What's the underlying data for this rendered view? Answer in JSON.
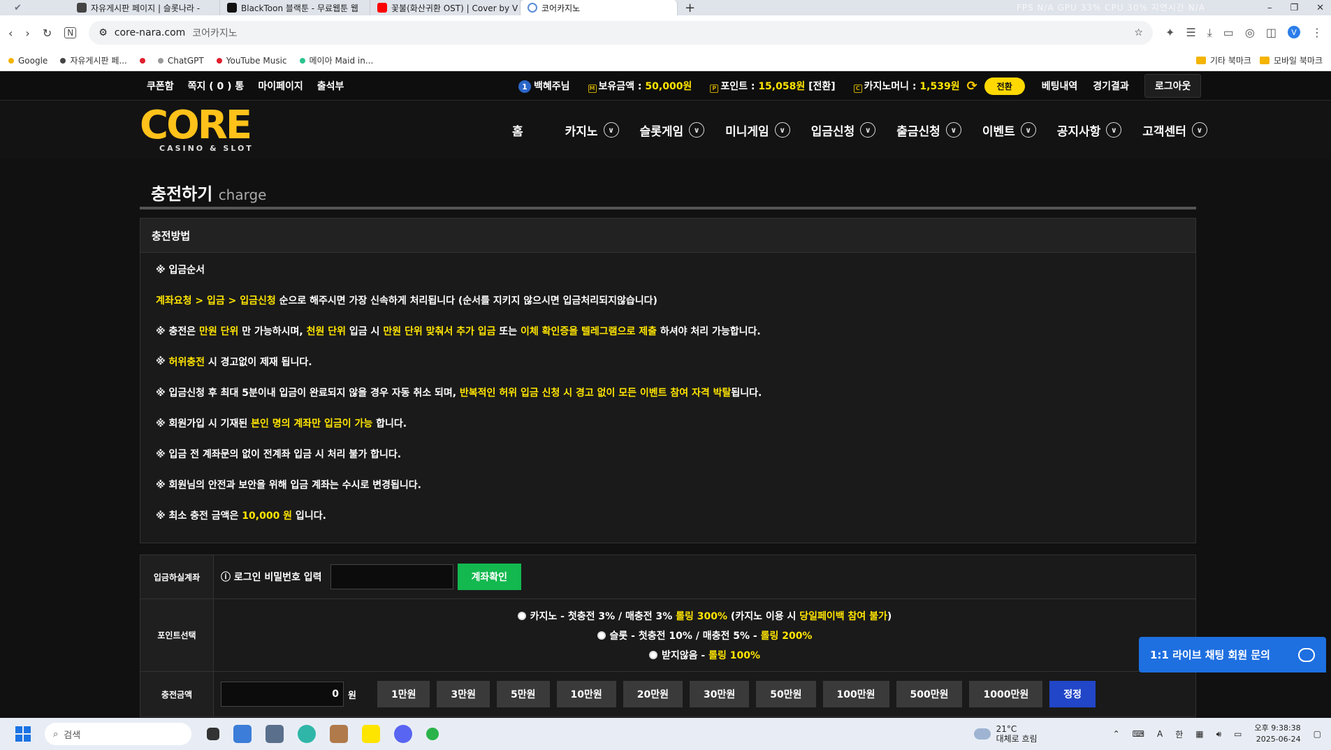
{
  "browser": {
    "tabs": [
      {
        "title": "자유게시판 페이지 | 슬롯나라 -",
        "color": "#444444"
      },
      {
        "title": "BlackToon 블랙툰 - 무료웹툰 웹",
        "color": "#111111"
      },
      {
        "title": "꽃불(화산귀환 OST) | Cover by V",
        "color": "#ff0000"
      },
      {
        "title": "코어카지노",
        "color": "#5b8cd6"
      }
    ],
    "new_tab": "+",
    "overlay": "FPS N/A   GPU 33%   CPU 30%   지연시간 N/A",
    "url_host": "core-nara.com",
    "url_title": "코어카지노",
    "bookmarks": [
      {
        "label": "Google",
        "color": "#f4b400"
      },
      {
        "label": "자유게시판 페...",
        "color": "#444444"
      },
      {
        "label": "",
        "color": "#e01e2d"
      },
      {
        "label": "ChatGPT",
        "color": "#999999"
      },
      {
        "label": "YouTube Music",
        "color": "#e01e2d"
      },
      {
        "label": "메이아 Maid in...",
        "color": "#2bc38d"
      }
    ],
    "bookmarks_right": [
      "기타 북마크",
      "모바일 북마크"
    ],
    "avatar": "V"
  },
  "topbar": {
    "left_links": [
      "쿠폰함",
      "쪽지 ( 0 ) 통",
      "마이페이지",
      "출석부"
    ],
    "level": "1",
    "username": "백혜주님",
    "balance_label": "보유금액 :",
    "balance_value": "50,000원",
    "point_label": "포인트 :",
    "point_value": "15,058원",
    "point_convert": "[전환]",
    "casino_label": "카지노머니 :",
    "casino_value": "1,539원",
    "convert_button": "전환",
    "bet_history": "베팅내역",
    "game_result": "경기결과",
    "logout": "로그아웃"
  },
  "header": {
    "logo_main": "CORE",
    "logo_sub": "CASINO & SLOT",
    "nav": [
      "홈",
      "카지노",
      "슬롯게임",
      "미니게임",
      "입금신청",
      "출금신청",
      "이벤트",
      "공지사항",
      "고객센터"
    ]
  },
  "page": {
    "title": "충전하기",
    "title_en": "charge",
    "method_header": "충전방법",
    "lines": [
      [
        {
          "t": "※ 입금순서",
          "y": false
        }
      ],
      [
        {
          "t": "계좌요청 > 입금 > 입금신청",
          "y": true
        },
        {
          "t": " 순으로 해주시면 가장 신속하게 처리됩니다 (순서를 지키지 않으시면 입금처리되지않습니다)",
          "y": false
        }
      ],
      [
        {
          "t": "※ 충전은 ",
          "y": false
        },
        {
          "t": "만원 단위",
          "y": true
        },
        {
          "t": " 만 가능하시며, ",
          "y": false
        },
        {
          "t": "천원 단위",
          "y": true
        },
        {
          "t": " 입금 시 ",
          "y": false
        },
        {
          "t": "만원 단위 맞춰서 추가 입금",
          "y": true
        },
        {
          "t": " 또는 ",
          "y": false
        },
        {
          "t": "이체 확인증을 텔레그램으로 제출",
          "y": true
        },
        {
          "t": " 하셔야 처리 가능합니다.",
          "y": false
        }
      ],
      [
        {
          "t": "※ ",
          "y": false
        },
        {
          "t": "허위충전",
          "y": true
        },
        {
          "t": " 시 경고없이 제재 됩니다.",
          "y": false
        }
      ],
      [
        {
          "t": "※ 입금신청 후 최대 5분이내 입금이 완료되지 않을 경우 자동 취소 되며, ",
          "y": false
        },
        {
          "t": "반복적인 허위 입금 신청 시 경고 없이 모든 이벤트 참여 자격 박탈",
          "y": true
        },
        {
          "t": "됩니다.",
          "y": false
        }
      ],
      [
        {
          "t": "※ 회원가입 시 기재된 ",
          "y": false
        },
        {
          "t": "본인 명의 계좌만 입금이 가능",
          "y": true
        },
        {
          "t": " 합니다.",
          "y": false
        }
      ],
      [
        {
          "t": "※ 입금 전 계좌문의 없이 전계좌 입금 시 처리 불가 합니다.",
          "y": false
        }
      ],
      [
        {
          "t": "※ 회원님의 안전과 보안을 위해 입금 계좌는 수시로 변경됩니다.",
          "y": false
        }
      ],
      [
        {
          "t": "※ 최소 충전 금액은 ",
          "y": false
        },
        {
          "t": "10,000 원",
          "y": true
        },
        {
          "t": " 입니다.",
          "y": false
        }
      ]
    ]
  },
  "form": {
    "account_label": "입금하실계좌",
    "password_prompt": "ⓘ 로그인 비밀번호 입력",
    "confirm_button": "계좌확인",
    "point_label": "포인트선택",
    "options": [
      [
        {
          "t": "카지노 - 첫충전 3% / 매충전 3% ",
          "y": false
        },
        {
          "t": "롤링 300%",
          "y": true
        },
        {
          "t": " (카지노 이용 시 ",
          "y": false
        },
        {
          "t": "당일페이백 참여 불가",
          "y": true
        },
        {
          "t": ")",
          "y": false
        }
      ],
      [
        {
          "t": "슬롯 - 첫충전 10% / 매충전 5% - ",
          "y": false
        },
        {
          "t": "롤링 200%",
          "y": true
        }
      ],
      [
        {
          "t": "받지않음 - ",
          "y": false
        },
        {
          "t": "롤링 100%",
          "y": true
        }
      ]
    ],
    "amount_label": "충전금액",
    "amount_value": "0",
    "won": "원",
    "amount_buttons": [
      "1만원",
      "3만원",
      "5만원",
      "10만원",
      "20만원",
      "30만원",
      "50만원",
      "100만원",
      "500만원",
      "1000만원"
    ],
    "reset_button": "정정"
  },
  "chat": {
    "label": "1:1 라이브 채팅 회원 문의"
  },
  "taskbar": {
    "search": "검색",
    "weather_temp": "21°C",
    "weather_desc": "대체로 흐림",
    "ime": "한",
    "time": "오후 9:38:38",
    "date": "2025-06-24"
  },
  "colors": {
    "accent_yellow": "#ffe400",
    "green": "#13b84f",
    "blue": "#2146c8",
    "chat": "#1e6fe0"
  }
}
